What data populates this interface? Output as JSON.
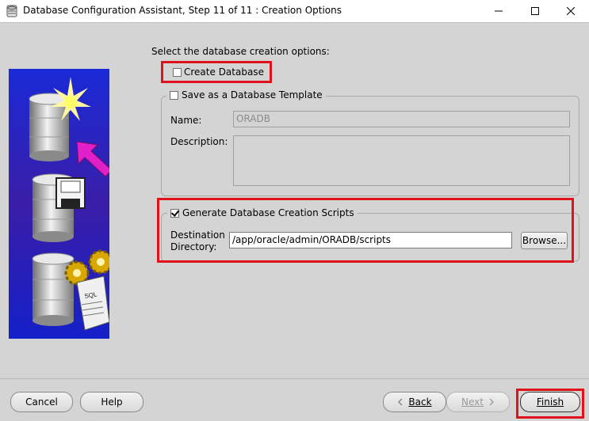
{
  "window": {
    "title": "Database Configuration Assistant, Step 11 of 11 : Creation Options",
    "icon": "database-app-icon"
  },
  "content": {
    "prompt": "Select the database creation options:",
    "create_database": {
      "label": "Create Database",
      "checked": false
    },
    "template_group": {
      "label": "Save as a Database Template",
      "checked": false,
      "name_label": "Name:",
      "name_value": "ORADB",
      "description_label": "Description:",
      "description_value": ""
    },
    "scripts_group": {
      "label": "Generate Database Creation Scripts",
      "checked": true,
      "destination_label_1": "Destination",
      "destination_label_2": "Directory:",
      "destination_value": "/app/oracle/admin/ORADB/scripts",
      "browse_label": "Browse..."
    }
  },
  "buttons": {
    "cancel": "Cancel",
    "help": "Help",
    "back": "Back",
    "next": "Next",
    "finish": "Finish"
  },
  "colors": {
    "highlight_red": "#e0121b",
    "background": "#d4d4d4",
    "image_blue": "#1b2ccf"
  }
}
